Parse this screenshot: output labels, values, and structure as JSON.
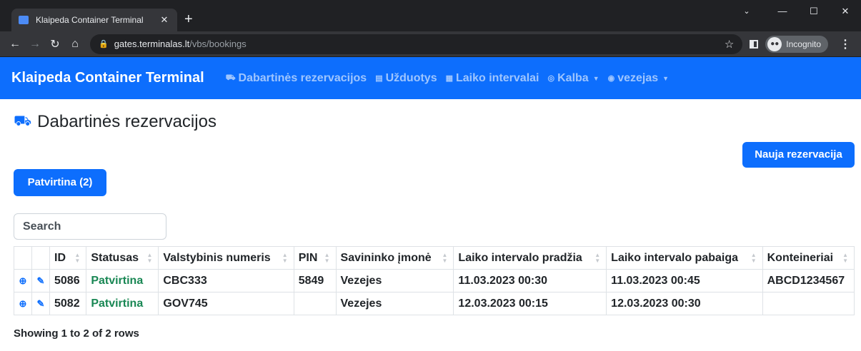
{
  "browser": {
    "tab_title": "Klaipeda Container Terminal",
    "close_tab": "✕",
    "new_tab": "+",
    "url_host": "gates.terminalas.lt",
    "url_path": "/vbs/bookings",
    "incognito_label": "Incognito"
  },
  "navbar": {
    "brand": "Klaipeda Container Terminal",
    "items": [
      {
        "icon": "truck-icon",
        "label": "Dabartinės rezervacijos"
      },
      {
        "icon": "tasks-icon",
        "label": "Užduotys"
      },
      {
        "icon": "calendar-icon",
        "label": "Laiko intervalai"
      },
      {
        "icon": "globe-icon",
        "label": "Kalba"
      },
      {
        "icon": "user-icon",
        "label": "vezejas"
      }
    ]
  },
  "page": {
    "title": "Dabartinės rezervacijos",
    "new_button": "Nauja rezervacija",
    "status_button": "Patvirtina (2)",
    "search_placeholder": "Search",
    "rows_info": "Showing 1 to 2 of 2 rows"
  },
  "table": {
    "headers": [
      "ID",
      "Statusas",
      "Valstybinis numeris",
      "PIN",
      "Savininko įmonė",
      "Laiko intervalo pradžia",
      "Laiko intervalo pabaiga",
      "Konteineriai"
    ],
    "rows": [
      [
        "5086",
        "Patvirtina",
        "CBC333",
        "5849",
        "Vezejes",
        "11.03.2023 00:30",
        "11.03.2023 00:45",
        "ABCD1234567"
      ],
      [
        "5082",
        "Patvirtina",
        "GOV745",
        "",
        "Vezejes",
        "12.03.2023 00:15",
        "12.03.2023 00:30",
        ""
      ]
    ]
  },
  "colors": {
    "primary": "#0d6efd",
    "status_green": "#198754"
  }
}
